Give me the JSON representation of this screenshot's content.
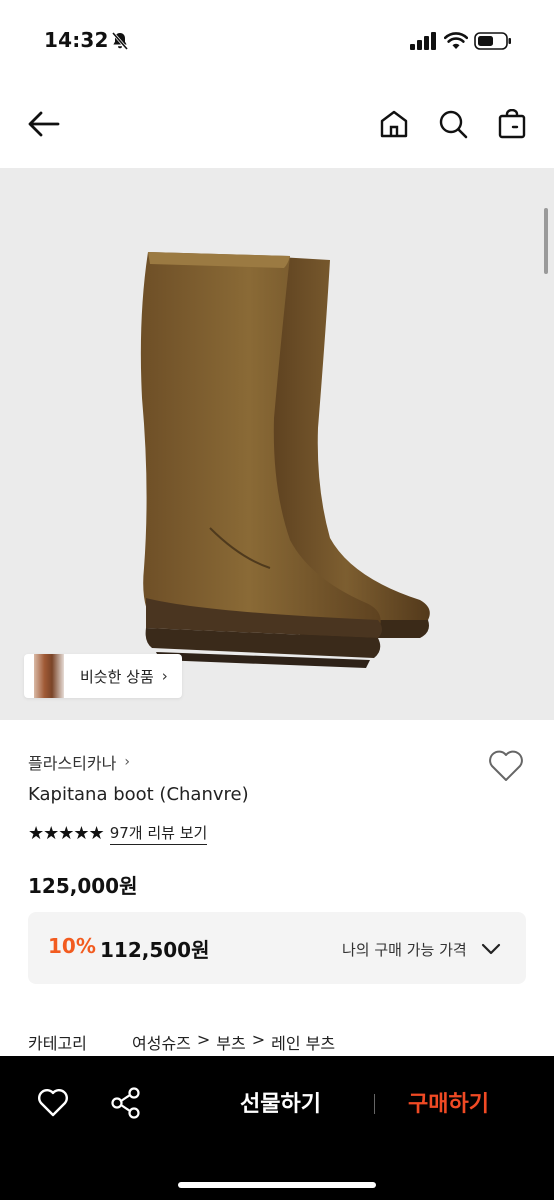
{
  "status_bar": {
    "time": "14:32"
  },
  "product": {
    "brand": "플라스티카나",
    "name": "Kapitana boot (Chanvre)",
    "rating_stars": "★★★★★",
    "reviews_link": "97개 리뷰 보기",
    "price": "125,000원",
    "similar_label": "비슷한 상품",
    "benefit": {
      "discount_rate": "10%",
      "discount_price": "112,500원",
      "my_price_label": "나의 구매 가능 가격"
    },
    "category": {
      "label": "카테고리",
      "path": [
        "여성슈즈",
        ">",
        "부츠",
        ">",
        "레인 부츠"
      ]
    }
  },
  "bottom_bar": {
    "gift_label": "선물하기",
    "buy_label": "구매하기"
  },
  "colors": {
    "accent": "#f25b1f",
    "buy": "#f04a24",
    "image_bg": "#ebebeb",
    "boot": "#7a5a2e"
  },
  "icons": {
    "back": "arrow-left-icon",
    "home": "home-icon",
    "search": "search-icon",
    "bag": "shopping-bag-icon",
    "wish": "heart-icon",
    "share": "share-icon"
  }
}
